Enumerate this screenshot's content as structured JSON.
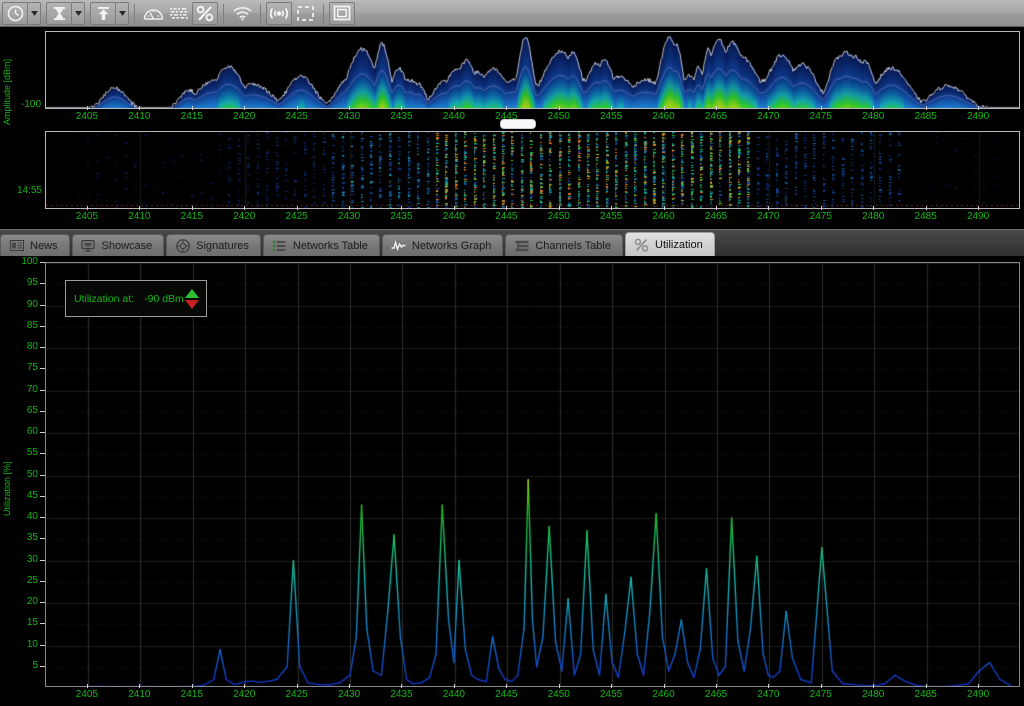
{
  "toolbar": {
    "buttons": [
      {
        "name": "clock-icon",
        "label": "Time Span",
        "has_dropdown": true
      },
      {
        "name": "hourglass-icon",
        "label": "Duration",
        "has_dropdown": true
      },
      {
        "name": "upload-arrow-icon",
        "label": "Export",
        "has_dropdown": true
      },
      {
        "name": "gauge-icon",
        "label": "Meter",
        "has_dropdown": false
      },
      {
        "name": "waterfall-icon",
        "label": "Waterfall",
        "has_dropdown": false
      },
      {
        "name": "percent-icon",
        "label": "Utilization",
        "has_dropdown": false
      },
      {
        "name": "wifi-icon",
        "label": "Wi-Fi",
        "has_dropdown": false
      },
      {
        "name": "signal-icon",
        "label": "Signal",
        "has_dropdown": false
      },
      {
        "name": "selection-icon",
        "label": "Selection",
        "has_dropdown": false
      },
      {
        "name": "window-icon",
        "label": "Window",
        "has_dropdown": false
      }
    ]
  },
  "spectrum": {
    "ylabel": "Amplitude [dBm]",
    "ymin_label": "-100",
    "xticks": [
      2405,
      2410,
      2415,
      2420,
      2425,
      2430,
      2435,
      2440,
      2445,
      2450,
      2455,
      2460,
      2465,
      2470,
      2475,
      2480,
      2485,
      2490
    ]
  },
  "waterfall": {
    "time_label": "14:55",
    "xticks": [
      2405,
      2410,
      2415,
      2420,
      2425,
      2430,
      2435,
      2440,
      2445,
      2450,
      2455,
      2460,
      2465,
      2470,
      2475,
      2480,
      2485,
      2490
    ]
  },
  "tabs": [
    {
      "label": "News",
      "icon": "news-icon",
      "active": false
    },
    {
      "label": "Showcase",
      "icon": "showcase-icon",
      "active": false
    },
    {
      "label": "Signatures",
      "icon": "signatures-icon",
      "active": false
    },
    {
      "label": "Networks Table",
      "icon": "networks-table-icon",
      "active": false
    },
    {
      "label": "Networks Graph",
      "icon": "networks-graph-icon",
      "active": false
    },
    {
      "label": "Channels Table",
      "icon": "channels-table-icon",
      "active": false
    },
    {
      "label": "Utilization",
      "icon": "utilization-icon",
      "active": true
    }
  ],
  "utilization_legend": {
    "label": "Utilization at:",
    "value": "-90 dBm",
    "up_arrow_color": "#2fbf2f",
    "down_arrow_color": "#c92121"
  },
  "colors": {
    "axis_text": "#16b516",
    "grid": "#2a2a2a",
    "plot_border": "#b8b8b8",
    "background": "#000000",
    "toolbar_bg": "#a8a8a8",
    "tab_active_bg": "#d2d2d2",
    "tab_inactive_bg": "#787878"
  },
  "chart_data": [
    {
      "type": "line",
      "id": "utilization-chart",
      "title": "",
      "xlabel": "",
      "ylabel": "Utilization [%]",
      "xlim": [
        2401,
        2494
      ],
      "ylim": [
        0,
        100
      ],
      "yticks": [
        5,
        10,
        15,
        20,
        25,
        30,
        35,
        40,
        45,
        50,
        55,
        60,
        65,
        70,
        75,
        80,
        85,
        90,
        95,
        100
      ],
      "xticks": [
        2405,
        2410,
        2415,
        2420,
        2425,
        2430,
        2435,
        2440,
        2445,
        2450,
        2455,
        2460,
        2465,
        2470,
        2475,
        2480,
        2485,
        2490
      ],
      "grid": true,
      "legend": "none",
      "colormap": [
        "#1030c8",
        "#1878d0",
        "#18c0b0",
        "#20c020",
        "#b8d020",
        "#d04820"
      ],
      "x": [
        2401,
        2402,
        2403,
        2404,
        2405,
        2406,
        2407,
        2408,
        2409,
        2410,
        2411,
        2412,
        2413,
        2414,
        2415,
        2416,
        2417,
        2417.6,
        2418.2,
        2419,
        2420,
        2420.6,
        2421.4,
        2422,
        2423,
        2424,
        2424.6,
        2425.2,
        2426,
        2427,
        2428,
        2429,
        2430,
        2430.6,
        2431.1,
        2431.6,
        2432.2,
        2433,
        2433.6,
        2434.2,
        2434.8,
        2435.4,
        2436,
        2436.8,
        2437.6,
        2438.2,
        2438.8,
        2439.4,
        2439.9,
        2440.4,
        2441,
        2441.6,
        2442.2,
        2443,
        2443.6,
        2444.2,
        2444.8,
        2445.4,
        2446,
        2446.6,
        2447,
        2447.4,
        2447.8,
        2448.4,
        2449,
        2449.6,
        2450.2,
        2450.8,
        2451.4,
        2452,
        2452.6,
        2453.2,
        2453.8,
        2454.4,
        2455,
        2455.6,
        2456.2,
        2456.8,
        2457.4,
        2458,
        2458.6,
        2459.2,
        2459.8,
        2460.4,
        2461,
        2461.6,
        2462.2,
        2462.8,
        2463.4,
        2464,
        2464.6,
        2465.2,
        2465.8,
        2466.4,
        2467,
        2467.6,
        2468.2,
        2468.8,
        2469.4,
        2469.9,
        2470.4,
        2471,
        2471.6,
        2472.2,
        2473,
        2474,
        2475,
        2476,
        2477,
        2478,
        2479,
        2480,
        2481,
        2482,
        2483,
        2484,
        2485,
        2486,
        2487,
        2488,
        2489,
        2490,
        2491,
        2492,
        2493
      ],
      "values": [
        0,
        0,
        0,
        0,
        0.3,
        0.4,
        0.3,
        0.2,
        0.3,
        0.4,
        0.3,
        0.2,
        0.2,
        0.3,
        0.4,
        0.6,
        2.0,
        9.0,
        2.0,
        0.8,
        1.5,
        1.6,
        1.4,
        1.5,
        2.0,
        5.0,
        30.0,
        5.0,
        1.2,
        0.8,
        0.7,
        1.2,
        3.0,
        12.0,
        43.0,
        14.0,
        4.0,
        3.0,
        18.0,
        36.0,
        12.0,
        2.0,
        1.0,
        1.2,
        2.5,
        8.0,
        43.0,
        16.0,
        6.0,
        30.0,
        9.0,
        3.0,
        2.0,
        1.5,
        12.0,
        4.5,
        2.0,
        1.5,
        3.0,
        14.0,
        49.0,
        16.0,
        5.0,
        12.0,
        38.0,
        11.0,
        4.0,
        21.0,
        3.0,
        8.0,
        37.0,
        9.0,
        3.0,
        22.0,
        6.0,
        2.5,
        13.0,
        26.0,
        8.0,
        3.0,
        18.0,
        41.0,
        12.0,
        4.0,
        8.0,
        16.0,
        6.0,
        2.5,
        9.0,
        28.0,
        7.0,
        3.0,
        5.0,
        40.0,
        11.0,
        4.0,
        14.0,
        31.0,
        8.0,
        3.0,
        2.5,
        4.0,
        18.0,
        7.0,
        2.0,
        1.2,
        33.0,
        4.0,
        1.0,
        0.8,
        0.6,
        0.5,
        1.0,
        3.0,
        1.5,
        0.6,
        0.4,
        0.3,
        0.4,
        0.6,
        1.0,
        4.0,
        6.0,
        2.0,
        0.6,
        0.3,
        0.2,
        0.2
      ]
    },
    {
      "type": "area",
      "id": "spectrum-chart",
      "ylabel": "Amplitude [dBm]",
      "xlim": [
        2401,
        2494
      ],
      "ylim": [
        -100,
        -20
      ],
      "description": "RF spectrum density plot, blue/cyan/green gradient traces with a white max-hold overlay line",
      "xticks": [
        2405,
        2410,
        2415,
        2420,
        2425,
        2430,
        2435,
        2440,
        2445,
        2450,
        2455,
        2460,
        2465,
        2470,
        2475,
        2480,
        2485,
        2490
      ]
    },
    {
      "type": "heatmap",
      "id": "waterfall-chart",
      "ylabel": "14:55",
      "xlim": [
        2401,
        2494
      ],
      "description": "Time-vs-frequency waterfall spectrogram, dark background with blue/green/orange activity stripes",
      "xticks": [
        2405,
        2410,
        2415,
        2420,
        2425,
        2430,
        2435,
        2440,
        2445,
        2450,
        2455,
        2460,
        2465,
        2470,
        2475,
        2480,
        2485,
        2490
      ]
    }
  ]
}
